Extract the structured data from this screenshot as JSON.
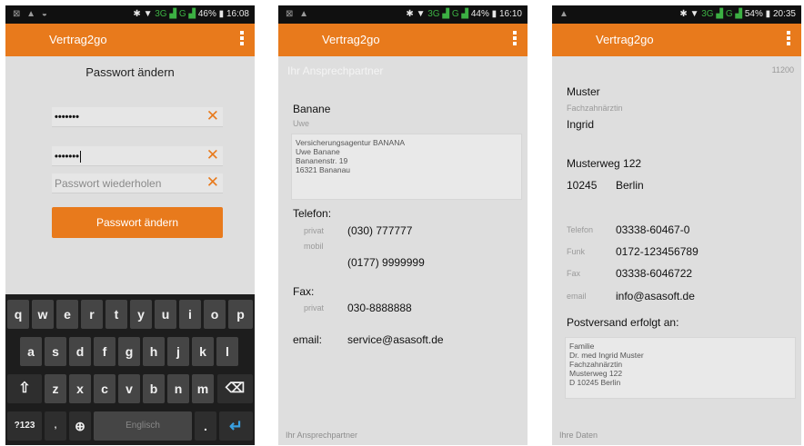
{
  "statusbar": {
    "p1": {
      "network": "3G",
      "battery": "46%",
      "time": "16:08"
    },
    "p2": {
      "network": "3G",
      "battery": "44%",
      "time": "16:10"
    },
    "p3": {
      "network": "3G",
      "battery": "54%",
      "time": "20:35"
    }
  },
  "app": {
    "title": "Vertrag2go"
  },
  "password_screen": {
    "heading": "Passwort ändern",
    "field1_value": "•••••••",
    "field2_value": "•••••••",
    "field3_placeholder": "Passwort wiederholen",
    "clear_glyph": "✕",
    "button_label": "Passwort ändern"
  },
  "keyboard": {
    "row1": [
      "q",
      "w",
      "e",
      "r",
      "t",
      "y",
      "u",
      "i",
      "o",
      "p"
    ],
    "row2": [
      "a",
      "s",
      "d",
      "f",
      "g",
      "h",
      "j",
      "k",
      "l"
    ],
    "row3": [
      "z",
      "x",
      "c",
      "v",
      "b",
      "n",
      "m"
    ],
    "shift": "⇧",
    "backspace": "⌫",
    "numbers": "?123",
    "comma": ",",
    "globe": "⊕",
    "space": "Englisch",
    "period": ".",
    "enter": "↵"
  },
  "contact_screen": {
    "section_title": "Ihr Ansprechpartner",
    "name": "Banane",
    "first_name": "Uwe",
    "address_lines": [
      "Versicherungsagentur BANANA",
      "Uwe Banane",
      "Bananenstr. 19",
      "16321 Bananau"
    ],
    "phone_label": "Telefon:",
    "private_label": "privat",
    "mobile_label": "mobil",
    "phone_private": "(030) 777777",
    "phone_mobile": "(0177) 9999999",
    "fax_label": "Fax:",
    "fax_private_label": "privat",
    "fax_private": "030-8888888",
    "email_label": "email:",
    "email": "service@asasoft.de",
    "footer": "Ihr Ansprechpartner"
  },
  "data_screen": {
    "id": "11200",
    "last_name": "Muster",
    "profession": "Fachzahnärztin",
    "first_name": "Ingrid",
    "street": "Musterweg 122",
    "zip": "10245",
    "city": "Berlin",
    "phone_label": "Telefon",
    "phone": "03338-60467-0",
    "mobile_label": "Funk",
    "mobile": "0172-123456789",
    "fax_label": "Fax",
    "fax": "03338-6046722",
    "email_label": "email",
    "email": "info@asasoft.de",
    "postal_label": "Postversand erfolgt an:",
    "postal_lines": [
      "Familie",
      "Dr. med Ingrid Muster",
      "Fachzahnärztin",
      "Musterweg 122",
      "D 10245 Berlin"
    ],
    "footer": "Ihre Daten"
  }
}
